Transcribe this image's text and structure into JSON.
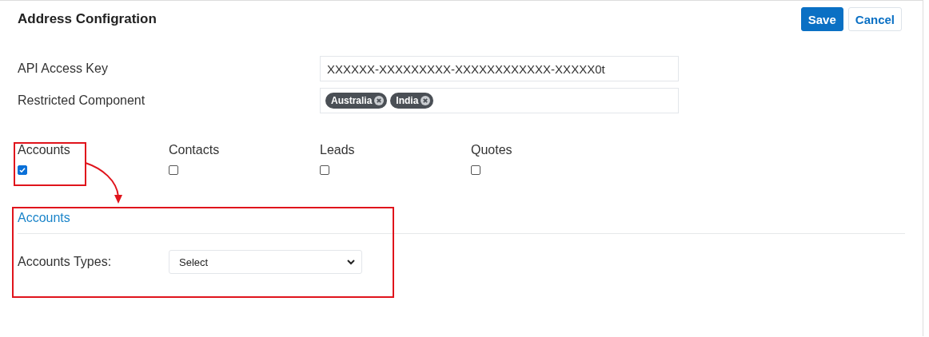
{
  "title": "Address Configration",
  "buttons": [
    {
      "label": "Save",
      "kind": "primary"
    },
    {
      "label": "Cancel",
      "kind": "secondary"
    }
  ],
  "fields": [
    {
      "label": "API Access Key",
      "kind": "text",
      "value": "XXXXXX-XXXXXXXXX-XXXXXXXXXXXX-XXXXX0t"
    },
    {
      "label": "Restricted Component",
      "kind": "tags",
      "tags": [
        "Australia",
        "India"
      ]
    }
  ],
  "modules": [
    {
      "label": "Accounts",
      "checked": true
    },
    {
      "label": "Contacts",
      "checked": false
    },
    {
      "label": "Leads",
      "checked": false
    },
    {
      "label": "Quotes",
      "checked": false
    }
  ],
  "section": {
    "title": "Accounts",
    "fields": [
      {
        "label": "Accounts Types:",
        "value": "Select"
      }
    ]
  }
}
